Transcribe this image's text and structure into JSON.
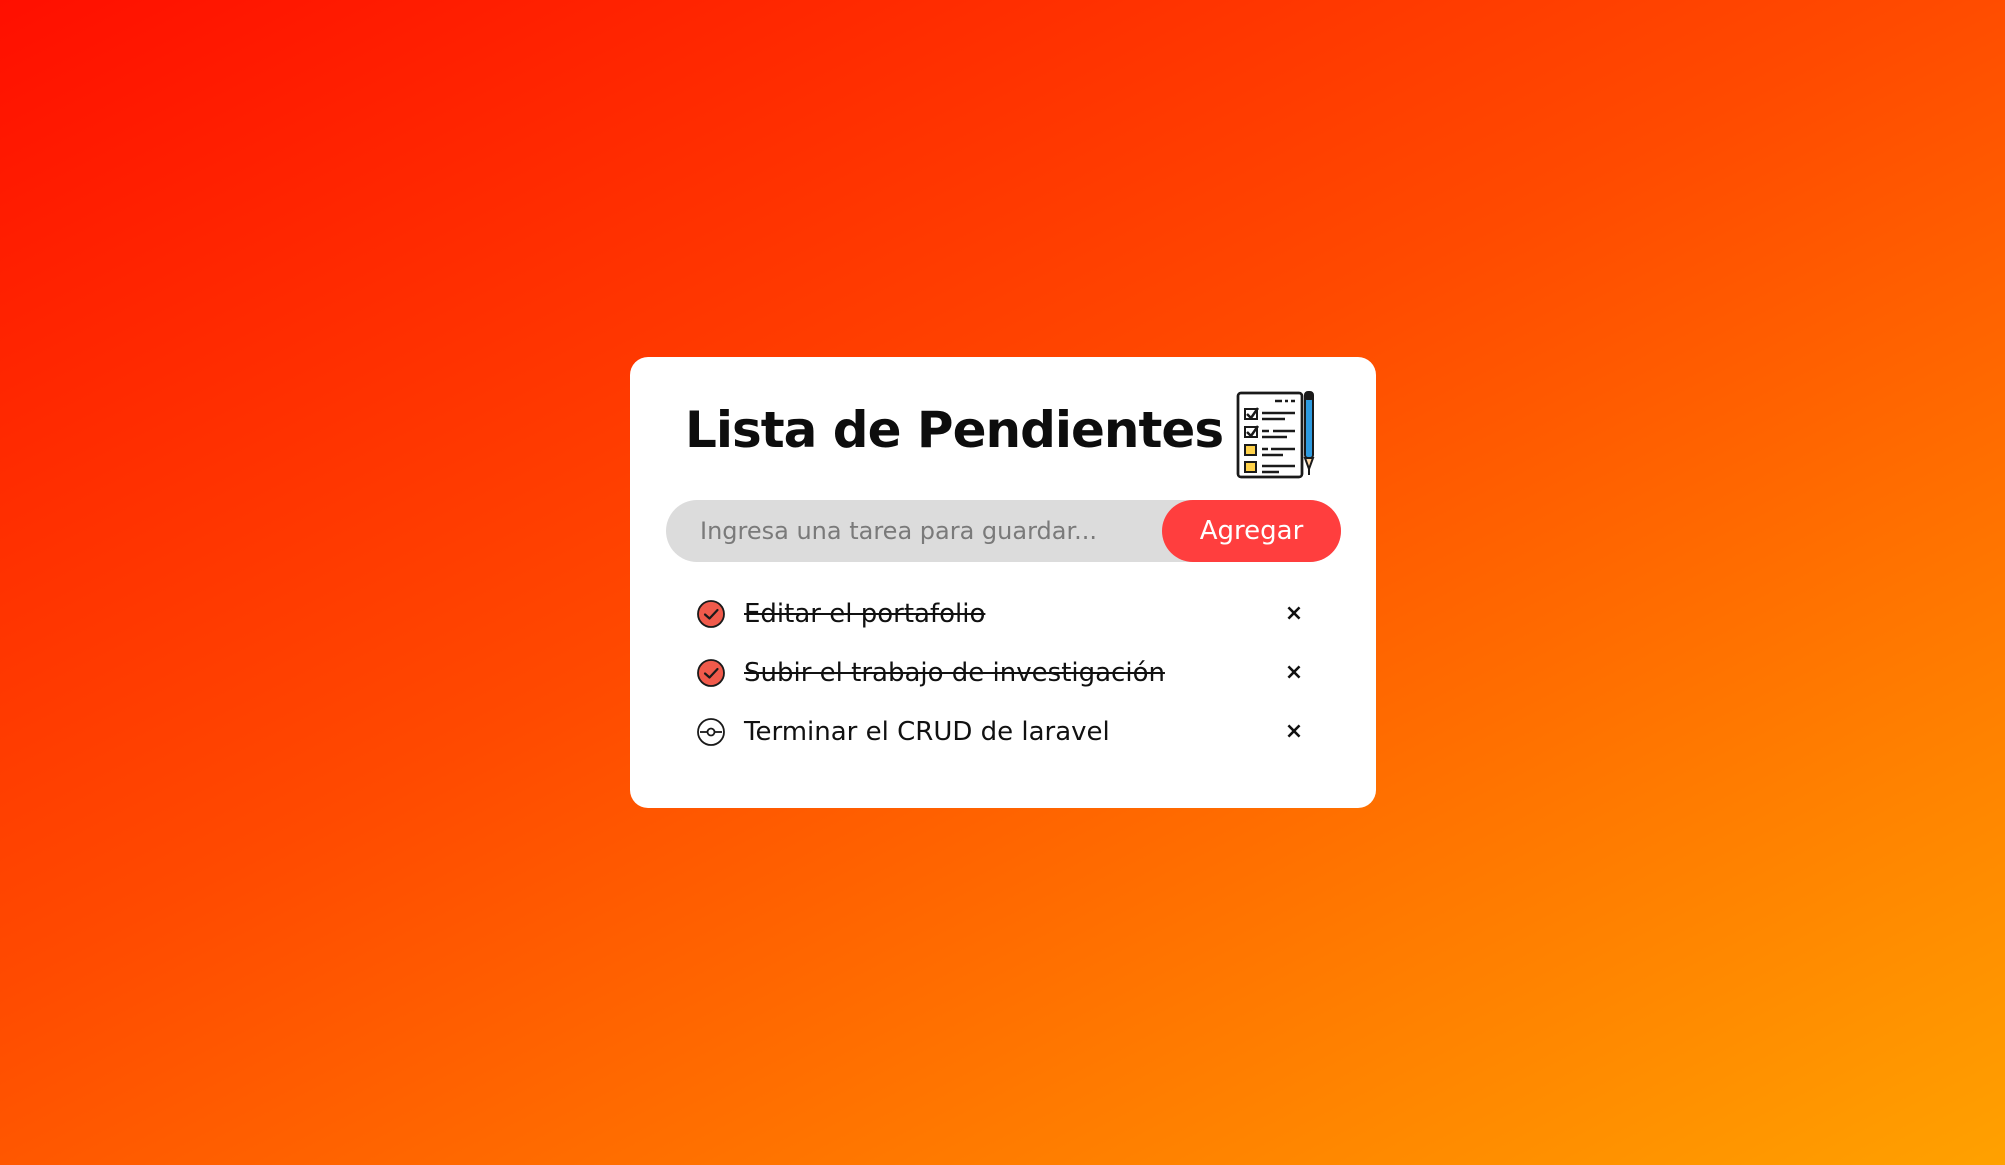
{
  "header": {
    "title": "Lista de Pendientes",
    "icon": "checklist-clipboard-icon"
  },
  "form": {
    "placeholder": "Ingresa una tarea para guardar...",
    "value": "",
    "button_label": "Agregar"
  },
  "tasks": [
    {
      "text": "Editar el portafolio",
      "done": true
    },
    {
      "text": "Subir el trabajo de investigación",
      "done": true
    },
    {
      "text": "Terminar el CRUD de laravel",
      "done": false
    }
  ],
  "delete_symbol": "×",
  "colors": {
    "background_start": "#ff0f00",
    "background_end": "#ffa100",
    "accent": "#ff3e3e",
    "check_fill": "#f05a4b",
    "input_bg": "#dcdcdc"
  }
}
